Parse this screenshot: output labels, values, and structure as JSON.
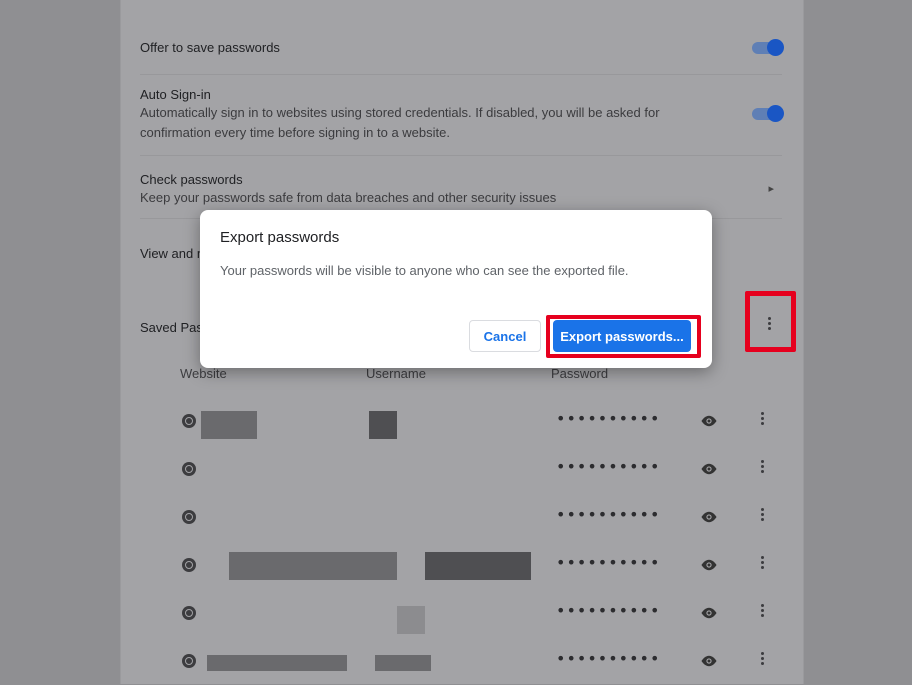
{
  "settings": {
    "offer_to_save": {
      "title": "Offer to save passwords",
      "enabled": true
    },
    "auto_signin": {
      "title": "Auto Sign-in",
      "subtitle_line1": "Automatically sign in to websites using stored credentials. If disabled, you will be asked for",
      "subtitle_line2": "confirmation every time before signing in to a website.",
      "enabled": true
    },
    "check_passwords": {
      "title": "Check passwords",
      "subtitle": "Keep your passwords safe from data breaches and other security issues"
    },
    "view_manage_partial": "View and m",
    "saved_passwords_partial": "Saved Pas"
  },
  "table": {
    "headers": {
      "website": "Website",
      "username": "Username",
      "password": "Password"
    },
    "rows": [
      {
        "password": "••••••••••"
      },
      {
        "password": "••••••••••"
      },
      {
        "password": "••••••••••"
      },
      {
        "password": "••••••••••"
      },
      {
        "password": "••••••••••"
      },
      {
        "password": "••••••••••"
      }
    ]
  },
  "dialog": {
    "title": "Export passwords",
    "body": "Your passwords will be visible to anyone who can see the exported file.",
    "cancel_label": "Cancel",
    "export_label": "Export passwords..."
  },
  "colors": {
    "accent": "#1a73e8",
    "highlight": "#e6001e"
  }
}
